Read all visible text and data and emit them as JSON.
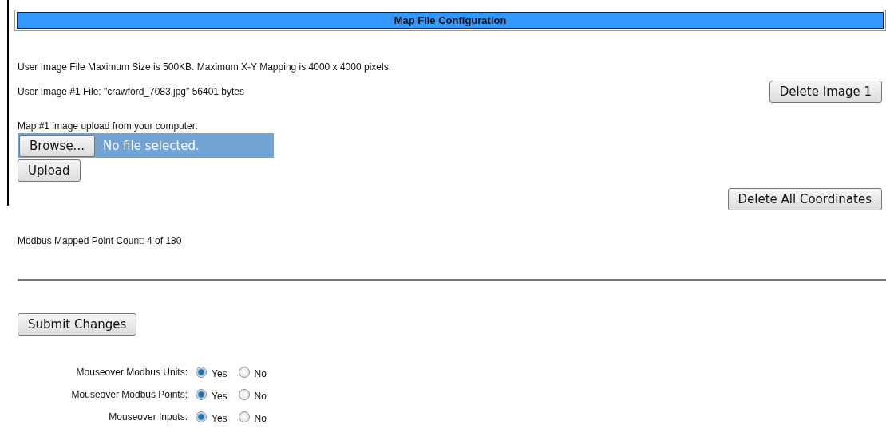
{
  "header": {
    "title": "Map File Configuration"
  },
  "info_text": "User Image File Maximum Size is 500KB. Maximum X-Y Mapping is 4000 x 4000 pixels.",
  "image_file_text": "User Image #1 File: \"crawford_7083.jpg\" 56401 bytes",
  "delete_image_button": "Delete Image 1",
  "upload_label": "Map #1 image upload from your computer:",
  "file_picker": {
    "button": "Browse...",
    "status": "No file selected."
  },
  "upload_button": "Upload",
  "delete_coordinates_button": "Delete All Coordinates",
  "point_count_text": "Modbus Mapped Point Count: 4 of 180",
  "submit_button": "Submit Changes",
  "options": [
    {
      "label": "Mouseover Modbus Units:",
      "choices": [
        {
          "label": "Yes",
          "selected": true
        },
        {
          "label": "No",
          "selected": false
        }
      ]
    },
    {
      "label": "Mouseover Modbus Points:",
      "choices": [
        {
          "label": "Yes",
          "selected": true
        },
        {
          "label": "No",
          "selected": false
        }
      ]
    },
    {
      "label": "Mouseover Inputs:",
      "choices": [
        {
          "label": "Yes",
          "selected": true
        },
        {
          "label": "No",
          "selected": false
        }
      ]
    }
  ]
}
